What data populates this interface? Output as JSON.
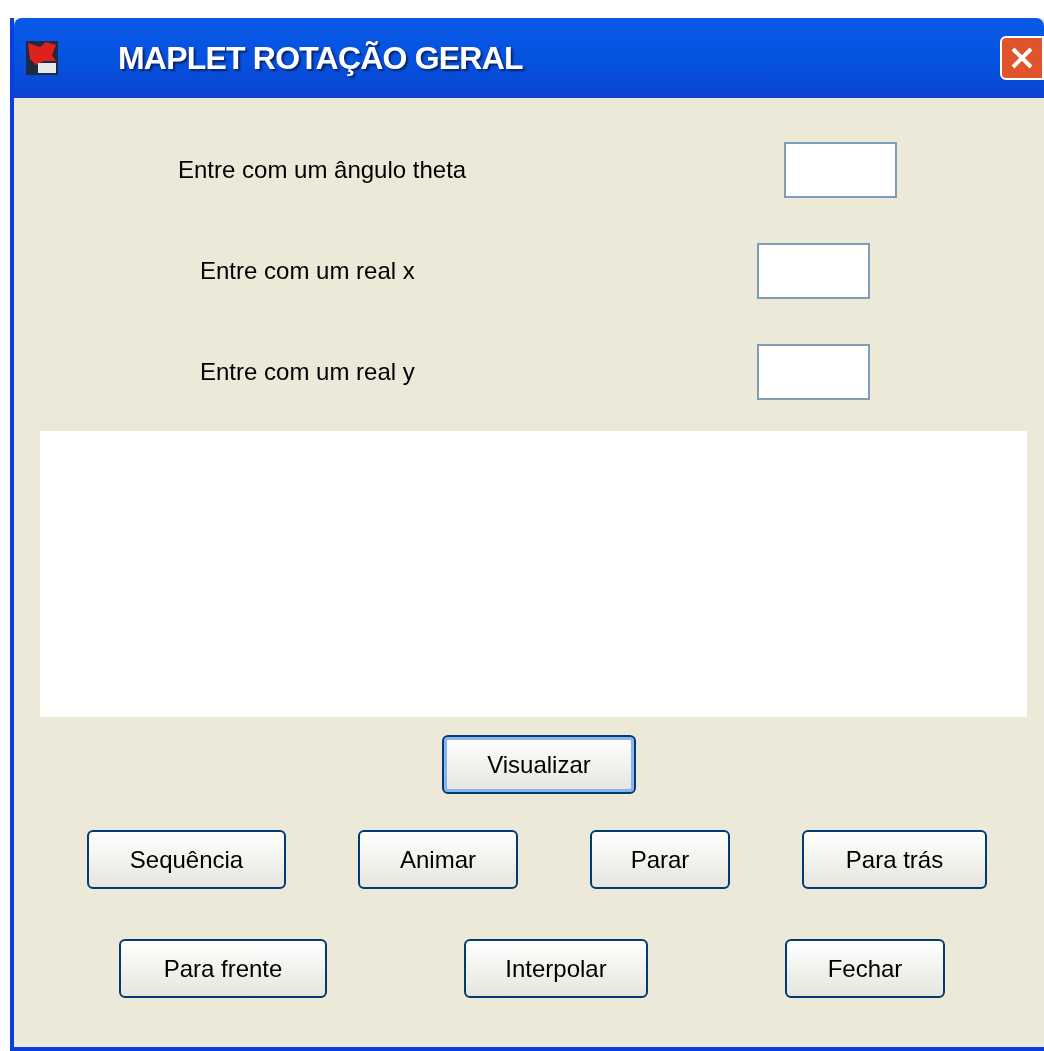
{
  "window": {
    "title": "MAPLET  ROTAÇÃO GERAL"
  },
  "fields": [
    {
      "label": "Entre com um ângulo theta"
    },
    {
      "label": "Entre com um real x"
    },
    {
      "label": "Entre com um real y"
    }
  ],
  "button_rows": [
    [
      {
        "label": "Visualizar",
        "focused": true
      }
    ],
    [
      {
        "label": "Sequência",
        "focused": false
      },
      {
        "label": "Animar",
        "focused": false
      },
      {
        "label": "Parar",
        "focused": false
      },
      {
        "label": "Para trás",
        "focused": false
      }
    ],
    [
      {
        "label": "Para frente",
        "focused": false
      },
      {
        "label": "Interpolar",
        "focused": false
      },
      {
        "label": "Fechar",
        "focused": false
      }
    ]
  ]
}
